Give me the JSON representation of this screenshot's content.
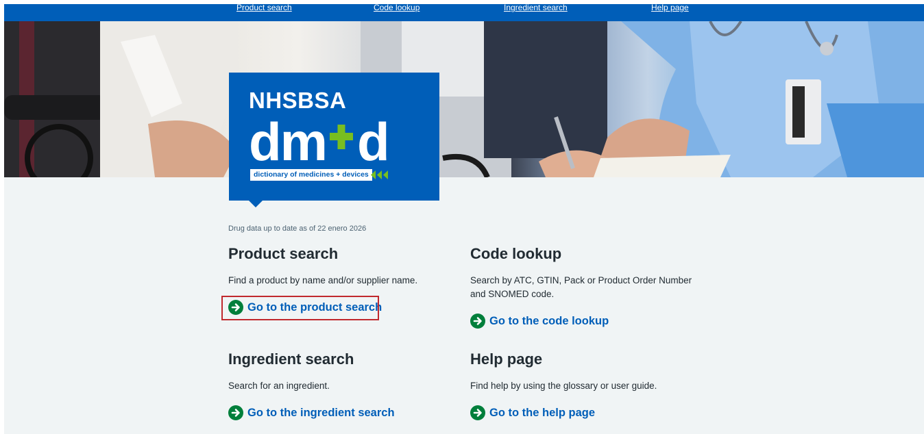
{
  "topnav": {
    "product_search": "Product search",
    "code_lookup": "Code lookup",
    "ingredient_search": "Ingredient search",
    "help_page": "Help page"
  },
  "logo": {
    "org": "NHSBSA",
    "wordmark": "dm+d",
    "strap": "dictionary of medicines + devices"
  },
  "main": {
    "data_date": "Drug data up to date as of 22 enero 2026",
    "cards": [
      {
        "title": "Product search",
        "description": "Find a product by name and/or supplier name.",
        "link": "Go to the product search"
      },
      {
        "title": "Code lookup",
        "description": "Search by ATC, GTIN, Pack or Product Order Number and SNOMED code.",
        "link": "Go to the code lookup"
      },
      {
        "title": "Ingredient search",
        "description": "Search for an ingredient.",
        "link": "Go to the ingredient search"
      },
      {
        "title": "Help page",
        "description": "Find help by using the glossary or user guide.",
        "link": "Go to the help page"
      }
    ]
  },
  "colors": {
    "nhs_blue": "#005eb8",
    "nhs_green": "#007f3b",
    "dmd_plus_green": "#78be20",
    "highlight_red": "#c0282d",
    "background": "#f0f4f5",
    "text": "#212b32"
  },
  "icons": {
    "link_arrow": "arrow-right-circle-icon",
    "strap_chevrons": "triple-chevron-left-icon"
  }
}
